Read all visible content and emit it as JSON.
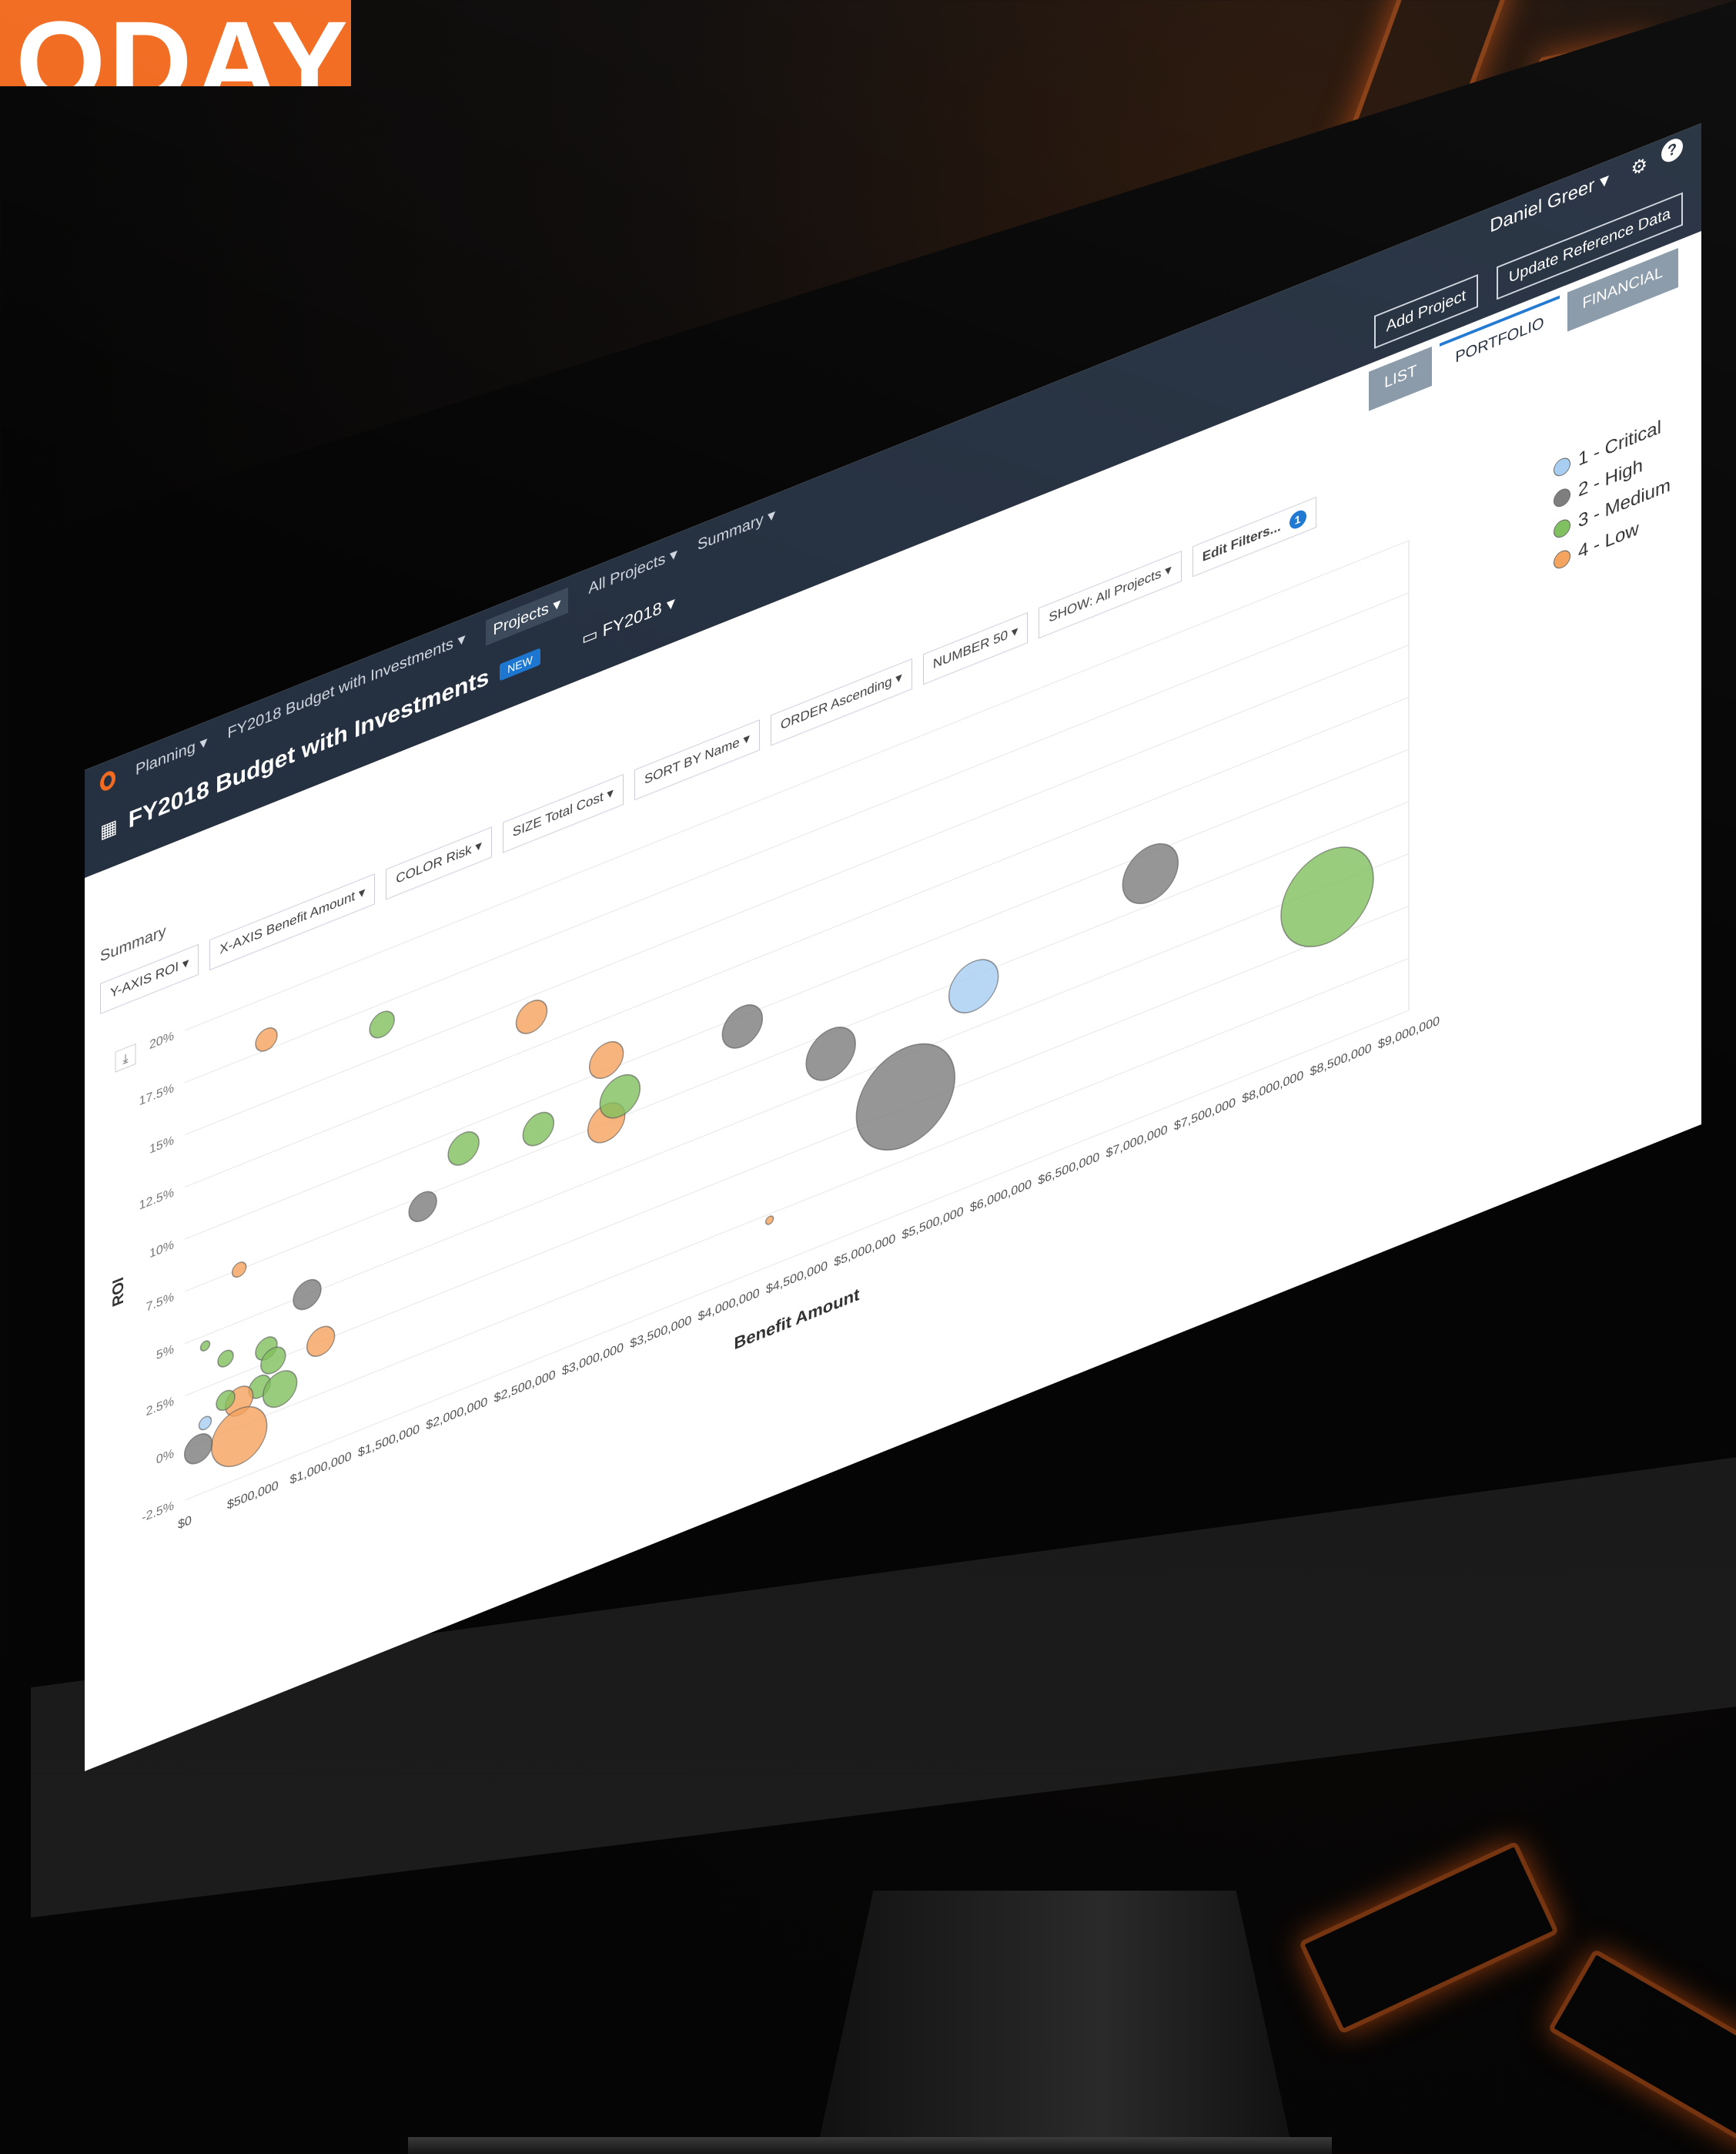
{
  "banner": {
    "text": "ODAY"
  },
  "app": {
    "nav": {
      "planning": "Planning ▾",
      "budget": "FY2018 Budget with Investments ▾",
      "projects": "Projects ▾",
      "all_projects": "All Projects ▾",
      "summary": "Summary ▾"
    },
    "title": "FY2018 Budget with Investments",
    "badge": "NEW",
    "fiscal_year": "FY2018 ▾",
    "user": "Daniel Greer ▾",
    "add_project": "Add Project",
    "update_reference": "Update Reference Data",
    "tabs": {
      "list": "LIST",
      "portfolio": "PORTFOLIO",
      "financial": "FINANCIAL"
    },
    "summary_label": "Summary",
    "controls": {
      "yaxis": "Y-AXIS ROI ▾",
      "xaxis": "X-AXIS Benefit Amount ▾",
      "color": "COLOR Risk ▾",
      "size": "SIZE Total Cost ▾",
      "sort": "SORT BY Name ▾",
      "order": "ORDER Ascending ▾",
      "number": "NUMBER 50 ▾",
      "show": "SHOW: All Projects ▾",
      "edit_filters": "Edit Filters...",
      "filter_count": "1"
    }
  },
  "colors": {
    "critical": "#a6cdf2",
    "high": "#7c7c7c",
    "medium": "#7fbf5d",
    "low": "#f5a35d"
  },
  "chart_data": {
    "type": "scatter",
    "xlabel": "Benefit Amount",
    "ylabel": "ROI",
    "xlim": [
      0,
      9000000
    ],
    "ylim": [
      -2.5,
      20
    ],
    "x_ticks": [
      "$0",
      "$500,000",
      "$1,000,000",
      "$1,500,000",
      "$2,000,000",
      "$2,500,000",
      "$3,000,000",
      "$3,500,000",
      "$4,000,000",
      "$4,500,000",
      "$5,000,000",
      "$5,500,000",
      "$6,000,000",
      "$6,500,000",
      "$7,000,000",
      "$7,500,000",
      "$8,000,000",
      "$8,500,000",
      "$9,000,000"
    ],
    "y_ticks": [
      "-2.5%",
      "0%",
      "2.5%",
      "5%",
      "7.5%",
      "10%",
      "12.5%",
      "15%",
      "17.5%",
      "20%"
    ],
    "legend": [
      {
        "name": "1 - Critical",
        "color": "critical"
      },
      {
        "name": "2 - High",
        "color": "high"
      },
      {
        "name": "3 - Medium",
        "color": "medium"
      },
      {
        "name": "4 - Low",
        "color": "low"
      }
    ],
    "points": [
      {
        "x": 600000,
        "y": 18,
        "r": 14,
        "s": "low"
      },
      {
        "x": 1450000,
        "y": 16.5,
        "r": 16,
        "s": "medium"
      },
      {
        "x": 2550000,
        "y": 14,
        "r": 20,
        "s": "low"
      },
      {
        "x": 3100000,
        "y": 10.5,
        "r": 22,
        "s": "low"
      },
      {
        "x": 3100000,
        "y": 7.5,
        "r": 24,
        "s": "low"
      },
      {
        "x": 3200000,
        "y": 8.5,
        "r": 26,
        "s": "medium"
      },
      {
        "x": 2600000,
        "y": 8.5,
        "r": 20,
        "s": "medium"
      },
      {
        "x": 2050000,
        "y": 9,
        "r": 20,
        "s": "medium"
      },
      {
        "x": 1750000,
        "y": 7,
        "r": 18,
        "s": "high"
      },
      {
        "x": 4100000,
        "y": 9.5,
        "r": 26,
        "s": "high"
      },
      {
        "x": 4750000,
        "y": 6.5,
        "r": 32,
        "s": "high"
      },
      {
        "x": 5300000,
        "y": 3,
        "r": 64,
        "s": "high"
      },
      {
        "x": 5800000,
        "y": 7,
        "r": 32,
        "s": "critical"
      },
      {
        "x": 7100000,
        "y": 9,
        "r": 36,
        "s": "high"
      },
      {
        "x": 8400000,
        "y": 4.5,
        "r": 60,
        "s": "medium"
      },
      {
        "x": 4300000,
        "y": -0.3,
        "r": 5,
        "s": "low"
      },
      {
        "x": 400000,
        "y": 7.5,
        "r": 9,
        "s": "low"
      },
      {
        "x": 900000,
        "y": 5,
        "r": 18,
        "s": "high"
      },
      {
        "x": 1000000,
        "y": 2.5,
        "r": 18,
        "s": "low"
      },
      {
        "x": 150000,
        "y": 4.5,
        "r": 6,
        "s": "medium"
      },
      {
        "x": 300000,
        "y": 3.5,
        "r": 10,
        "s": "medium"
      },
      {
        "x": 600000,
        "y": 3.2,
        "r": 14,
        "s": "medium"
      },
      {
        "x": 650000,
        "y": 2.5,
        "r": 16,
        "s": "medium"
      },
      {
        "x": 550000,
        "y": 1.5,
        "r": 14,
        "s": "medium"
      },
      {
        "x": 400000,
        "y": 1.2,
        "r": 18,
        "s": "low"
      },
      {
        "x": 700000,
        "y": 1.0,
        "r": 22,
        "s": "medium"
      },
      {
        "x": 300000,
        "y": 1.5,
        "r": 12,
        "s": "medium"
      },
      {
        "x": 150000,
        "y": 0.8,
        "r": 8,
        "s": "critical"
      },
      {
        "x": 400000,
        "y": -0.5,
        "r": 36,
        "s": "low"
      },
      {
        "x": 100000,
        "y": -0.3,
        "r": 18,
        "s": "high"
      }
    ]
  }
}
